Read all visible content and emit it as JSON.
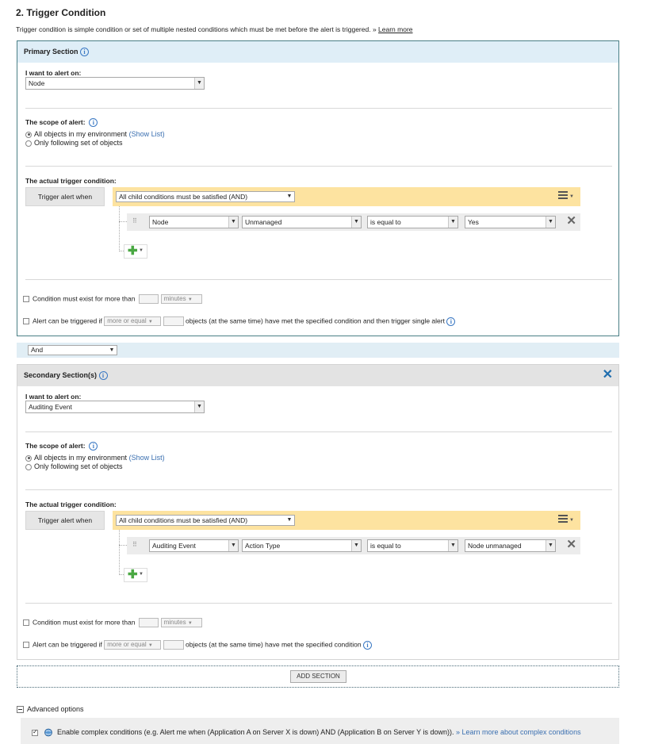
{
  "heading": "2. Trigger Condition",
  "description": "Trigger condition is simple condition or set of multiple nested conditions which must be met before the alert is triggered.",
  "description_link_prefix": "» ",
  "description_link": "Learn more",
  "primary": {
    "title": "Primary Section",
    "alert_on_label": "I want to alert on:",
    "alert_on_value": "Node",
    "scope_label": "The scope of alert:",
    "scope_all": "All objects in my environment",
    "scope_all_link": "(Show List)",
    "scope_following": "Only following set of objects",
    "trigger_label": "The actual trigger condition:",
    "trigger_when": "Trigger alert when",
    "group_select": "All child conditions must be satisfied (AND)",
    "condition": {
      "field": "Node",
      "property": "Unmanaged",
      "operator": "is equal to",
      "value": "Yes"
    },
    "exist_label": "Condition must exist for more than",
    "exist_unit": "minutes",
    "can_trigger_label": "Alert can be triggered if",
    "can_trigger_select": "more or equal",
    "can_trigger_tail": "objects (at the same time) have met the specified condition and then trigger single alert"
  },
  "joiner": "And",
  "secondary": {
    "title": "Secondary Section(s)",
    "alert_on_label": "I want to alert on:",
    "alert_on_value": "Auditing Event",
    "scope_label": "The scope of alert:",
    "scope_all": "All objects in my environment",
    "scope_all_link": "(Show List)",
    "scope_following": "Only following set of objects",
    "trigger_label": "The actual trigger condition:",
    "trigger_when": "Trigger alert when",
    "group_select": "All child conditions must be satisfied (AND)",
    "condition": {
      "field": "Auditing Event",
      "property": "Action Type",
      "operator": "is equal to",
      "value": "Node unmanaged"
    },
    "exist_label": "Condition must exist for more than",
    "exist_unit": "minutes",
    "can_trigger_label": "Alert can be triggered if",
    "can_trigger_select": "more or equal",
    "can_trigger_tail": "objects (at the same time) have met the specified condition"
  },
  "add_section": "ADD SECTION",
  "advanced_options": "Advanced options",
  "complex_text": "Enable complex conditions (e.g. Alert me when (Application A on Server X is down) AND (Application B on Server Y is down)).",
  "complex_link_prefix": "» ",
  "complex_link": "Learn more about complex conditions",
  "colors": {
    "accent": "#1f6dae",
    "band": "#fde3a0",
    "primary_head": "#dfeef7",
    "secondary_head": "#e3e3e3"
  }
}
